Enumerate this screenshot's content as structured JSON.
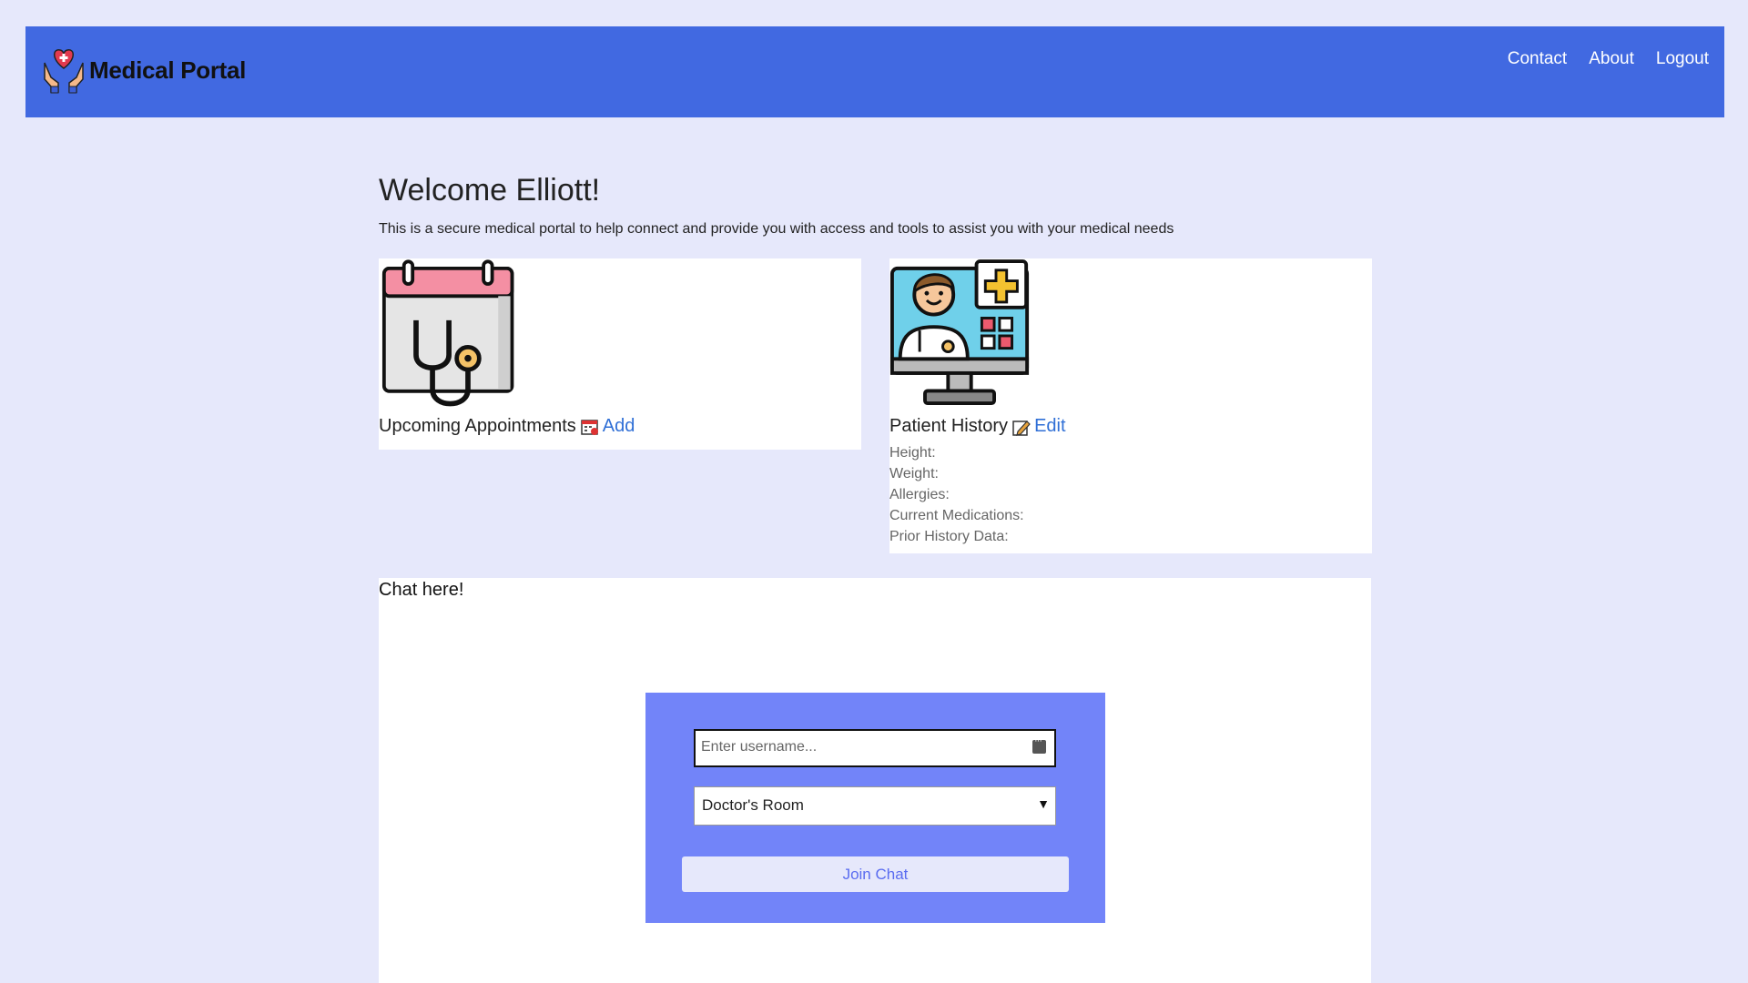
{
  "navbar": {
    "brand": "Medical Portal",
    "brand_icon": "hands-heart-icon",
    "links": [
      "Contact",
      "About",
      "Logout"
    ],
    "color": "#4169e1"
  },
  "main": {
    "welcome": "Welcome Elliott!",
    "intro": "This is a secure medical portal to help connect and provide you with access and tools to assist you with your medical needs"
  },
  "appointments": {
    "image_icon": "calendar-stethoscope-icon",
    "title": "Upcoming Appointments",
    "action_icon": "calendar-add-icon",
    "action": "Add"
  },
  "history": {
    "image_icon": "doctor-monitor-icon",
    "title": "Patient History",
    "action_icon": "edit-pencil-icon",
    "action": "Edit",
    "fields": [
      "Height:",
      "Weight:",
      "Allergies:",
      "Current Medications:",
      "Prior History Data:"
    ]
  },
  "chat": {
    "title": "Chat here!",
    "username_placeholder": "Enter username...",
    "room_selected": "Doctor's Room",
    "join_label": "Join Chat",
    "form_color": "#7284f9"
  }
}
